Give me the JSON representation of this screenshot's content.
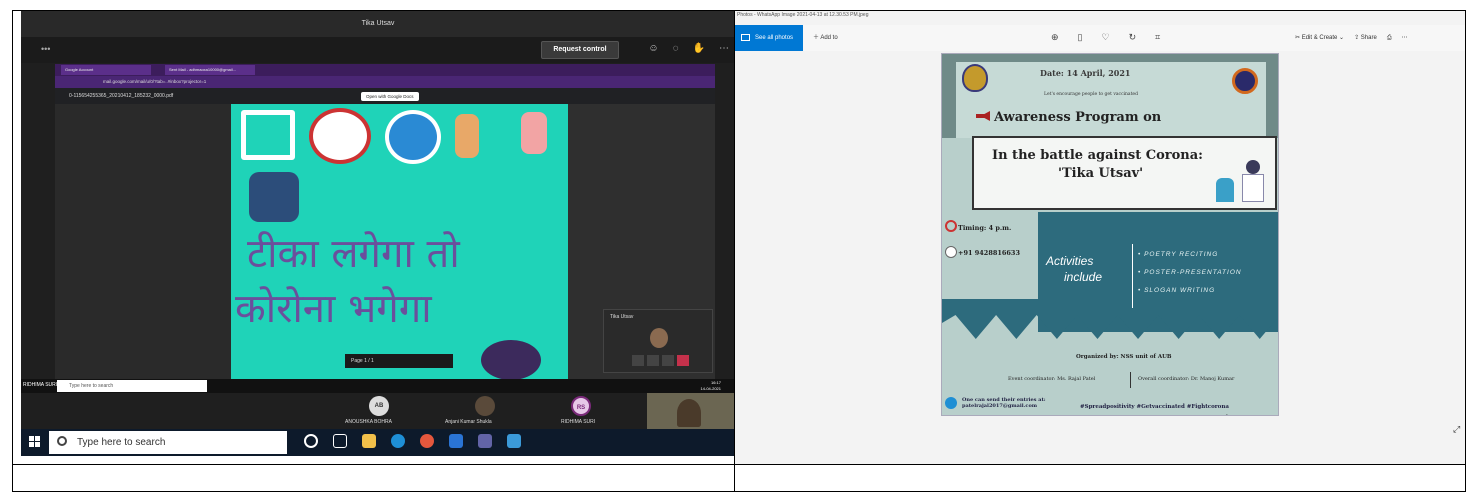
{
  "left_panel": {
    "window_title": "Tika Utsav",
    "request_control_label": "Request control",
    "toolbar_dots": "•••",
    "chrome_tabs": [
      "Google Account",
      "Sent Mail - adhmaoxa10000@gmail..."
    ],
    "url": "mail.google.com/mail/u/0/?tab=..#inbox?projector=1",
    "gmail_file": "0-115654255365_20210412_185232_0000.pdf",
    "open_with_docs": "Open with Google Docs",
    "poster_line1": "टीका लगेगा तो",
    "poster_line2": "कोरोना भगेगा",
    "page_indicator": "Page  1  /  1",
    "mini_tile_name": "Tika Utsav",
    "mini_tile_time": "20:27",
    "inner_user_tag": "RIDHIMA SURI",
    "inner_search_placeholder": "Type here to search",
    "inner_time": "16:17",
    "inner_date": "14-04-2021",
    "participants": [
      {
        "initials": "AB",
        "name": "ANOUSHKA BOHRA"
      },
      {
        "initials": "",
        "name": "Anjani Kumar Shukla"
      },
      {
        "initials": "RS",
        "name": "RIDHIMA SURI"
      }
    ],
    "taskbar_search_placeholder": "Type here to search",
    "colors": {
      "teams_bg": "#1f1f1f",
      "poster_bg": "#1fd3b8",
      "hindi_text": "#6b4f9c"
    }
  },
  "right_panel": {
    "viewer_title": "Photos - WhatsApp Image 2021-04-13 at 12.30.53 PM.jpeg",
    "see_all_photos": "See all photos",
    "add_to": "Add to",
    "edit_create": "Edit & Create",
    "share": "Share",
    "flyer": {
      "date": "Date: 14 April, 2021",
      "encourage": "Let's encourage people to get vaccinated",
      "awareness": "Awareness Program on",
      "battle_line1": "In the battle against Corona:",
      "battle_line2": "'Tika Utsav'",
      "timing": "Timing: 4 p.m.",
      "phone": "+91 9428816633",
      "activities_line1": "Activities",
      "activities_line2": "include",
      "bullets": [
        "• POETRY RECITING",
        "• POSTER-PRESENTATION",
        "• SLOGAN WRITING"
      ],
      "organized_by": "Organized by: NSS unit of AUB",
      "event_coordinator": "Event coordinator: Ms. Rajal Patel",
      "overall_coordinator": "Overall coordinator: Dr. Manoj Kumar",
      "send_line1": "One can send their entries at:",
      "send_line2": "patelrajal2017@gmail.com",
      "hashtags": "#Spreadpositivity  #Getvaccinated  #Fightcorona"
    },
    "colors": {
      "accent": "#0078d4",
      "flyer_teal": "#2d6b7d",
      "flyer_bg": "#b8cfcb"
    }
  }
}
